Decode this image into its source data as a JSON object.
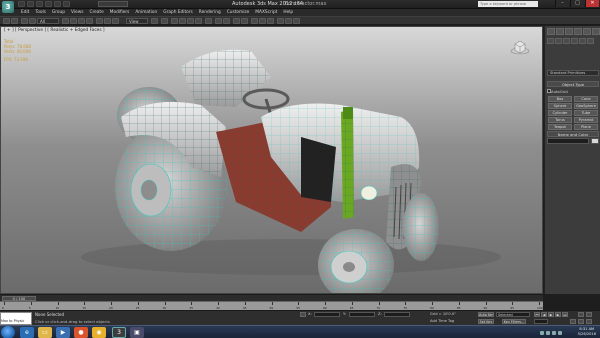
{
  "titlebar": {
    "app_title": "Autodesk 3ds Max 2012 x64",
    "file_title": "Ford tractor.max",
    "workspace": "",
    "search_placeholder": "Type a keyword or phrase"
  },
  "menu": {
    "items": [
      "Edit",
      "Tools",
      "Group",
      "Views",
      "Create",
      "Modifiers",
      "Animation",
      "Graph Editors",
      "Rendering",
      "Customize",
      "MAXScript",
      "Help"
    ]
  },
  "toolbar": {
    "filter_dropdown": "All",
    "view_dropdown": "View"
  },
  "viewport": {
    "label": "[ + ] [ Perspective ] [ Realistic + Edged Faces ]",
    "stats": {
      "header": "Total",
      "polys_label": "Polys:",
      "polys_value": "78,688",
      "verts_label": "Verts:",
      "verts_value": "40,006",
      "fps_label": "FPS:",
      "fps_value": "73.196"
    },
    "viewcube_label": "FRONT"
  },
  "command_panel": {
    "category": "Standard Primitives",
    "object_type_title": "Object Type",
    "autogrid_label": "AutoGrid",
    "objects": [
      "Box",
      "Cone",
      "Sphere",
      "GeoSphere",
      "Cylinder",
      "Tube",
      "Torus",
      "Pyramid",
      "Teapot",
      "Plane"
    ],
    "name_color_title": "Name and Color"
  },
  "timeline": {
    "frame_display": "0 / 100",
    "ticks": [
      "0",
      "5",
      "10",
      "15",
      "20",
      "25",
      "30",
      "35",
      "40",
      "45",
      "50",
      "55",
      "60",
      "65",
      "70",
      "75",
      "80",
      "85",
      "90",
      "95",
      "100"
    ]
  },
  "statusbar": {
    "maxscript_label": "Max to Physic",
    "selection": "None Selected",
    "prompt": "Click or click-and-drag to select objects",
    "x_value": "",
    "y_value": "",
    "z_value": "",
    "grid": "Grid = 10'0.0\"",
    "autokey": "Auto Key",
    "setkey": "Set Key",
    "selected_dropdown": "Selected",
    "keyfilters": "Key Filters...",
    "add_time_tag": "Add Time Tag"
  },
  "taskbar": {
    "time": "8:31 AM",
    "date": "5/26/2016"
  },
  "colors": {
    "viewport_top": "#d8d8d8",
    "viewport_bottom": "#6b6b6b",
    "wireframe": "#37c8c0",
    "tractor_body": "#c8c8c8",
    "tractor_red": "#8a3a2e",
    "exhaust_green": "#6aa822",
    "stats_text": "#c99b3a"
  }
}
